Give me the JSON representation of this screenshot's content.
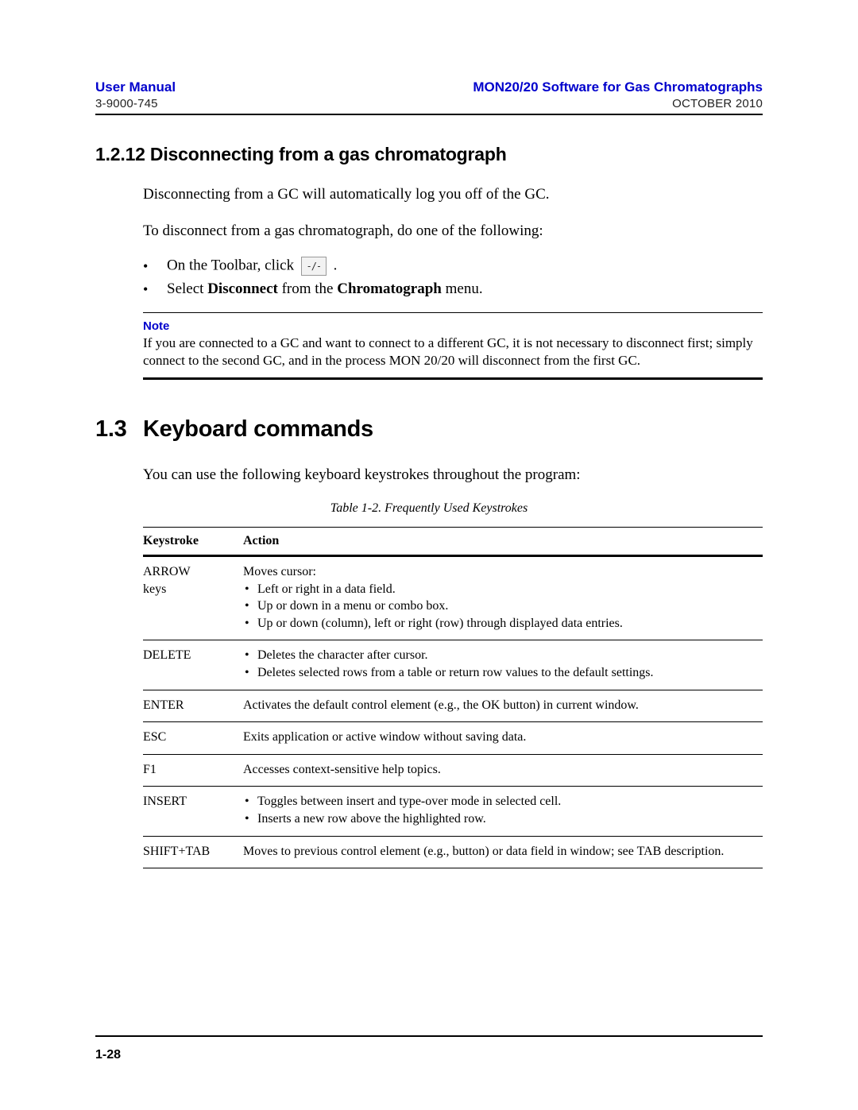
{
  "header": {
    "left_title": "User Manual",
    "left_sub": "3-9000-745",
    "right_title": "MON20/20 Software for Gas Chromatographs",
    "right_sub": "OCTOBER 2010"
  },
  "section_1_2_12": {
    "heading": "1.2.12 Disconnecting from a gas chromatograph",
    "p1": "Disconnecting from a GC will automatically log you off of the GC.",
    "p2": "To disconnect from a gas chromatograph, do one of the following:",
    "bullet1_pre": "On the Toolbar, click ",
    "bullet1_post": " .",
    "bullet2_pre": "Select ",
    "bullet2_b1": "Disconnect",
    "bullet2_mid": " from the ",
    "bullet2_b2": "Chromatograph",
    "bullet2_post": " menu."
  },
  "note": {
    "label": "Note",
    "body": "If you are connected to a GC and want to connect to a different GC, it is not necessary to disconnect first; simply connect to the second GC, and in the process MON 20/20 will disconnect from the first GC."
  },
  "section_1_3": {
    "number": "1.3",
    "title": "Keyboard commands",
    "p1": "You can use the following keyboard keystrokes throughout the program:"
  },
  "table": {
    "caption": "Table 1-2.  Frequently Used Keystrokes",
    "head_key": "Keystroke",
    "head_action": "Action",
    "rows": [
      {
        "key": "ARROW\nkeys",
        "lead": "Moves cursor:",
        "items": [
          "Left or right in a data field.",
          "Up or down in a menu or combo box.",
          "Up or down (column), left or right (row) through displayed data entries."
        ]
      },
      {
        "key": "DELETE",
        "lead": "",
        "items": [
          "Deletes the character after cursor.",
          "Deletes selected rows from a table or return row values to the default settings."
        ]
      },
      {
        "key": "ENTER",
        "plain": "Activates the default control element (e.g., the OK button) in current window."
      },
      {
        "key": "ESC",
        "plain": "Exits application or active window without saving data."
      },
      {
        "key": "F1",
        "plain": "Accesses context-sensitive help topics."
      },
      {
        "key": "INSERT",
        "lead": "",
        "items": [
          "Toggles between insert and type-over mode in selected cell.",
          "Inserts a new row above the highlighted row."
        ]
      },
      {
        "key": "SHIFT+TAB",
        "plain": "Moves to previous control element (e.g., button) or data field in window; see TAB description."
      }
    ]
  },
  "footer": {
    "page": "1-28"
  },
  "icons": {
    "disconnect": "-/-"
  }
}
